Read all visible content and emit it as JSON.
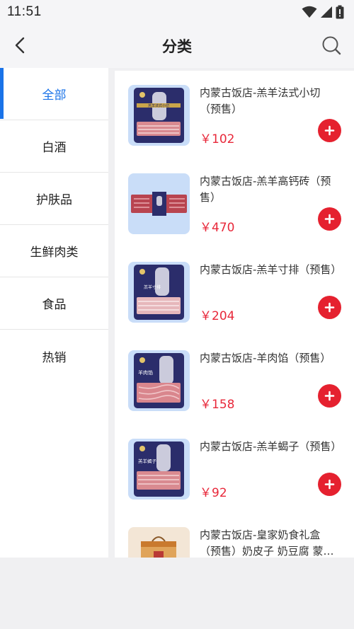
{
  "status_bar": {
    "time": "11:51"
  },
  "nav": {
    "title": "分类"
  },
  "categories": [
    {
      "label": "全部",
      "active": true
    },
    {
      "label": "白酒",
      "active": false
    },
    {
      "label": "护肤品",
      "active": false
    },
    {
      "label": "生鲜肉类",
      "active": false
    },
    {
      "label": "食品",
      "active": false
    },
    {
      "label": "热销",
      "active": false
    }
  ],
  "products": [
    {
      "name": "内蒙古饭店-羔羊法式小切（预售）",
      "price": "￥102",
      "pack_label": "羔羊法式小切"
    },
    {
      "name": "内蒙古饭店-羔羊高钙砖（预售）",
      "price": "￥470",
      "pack_label": ""
    },
    {
      "name": "内蒙古饭店-羔羊寸排（预售）",
      "price": "￥204",
      "pack_label": "羔羊寸排"
    },
    {
      "name": "内蒙古饭店-羊肉馅（预售）",
      "price": "￥158",
      "pack_label": "羊肉馅"
    },
    {
      "name": "内蒙古饭店-羔羊蝎子（预售）",
      "price": "￥92",
      "pack_label": "羔羊蝎子"
    },
    {
      "name": "内蒙古饭店-皇家奶食礼盒（预售）奶皮子 奶豆腐 蒙…",
      "price": "",
      "pack_label": ""
    }
  ],
  "colors": {
    "accent": "#1a73e8",
    "price": "#e8283a",
    "add_button": "#e5212f",
    "package": "#2b2d6b"
  },
  "icons": {
    "back": "chevron-left-icon",
    "search": "search-icon",
    "add": "plus-icon",
    "wifi": "wifi-icon",
    "signal": "signal-icon",
    "battery": "battery-icon"
  }
}
